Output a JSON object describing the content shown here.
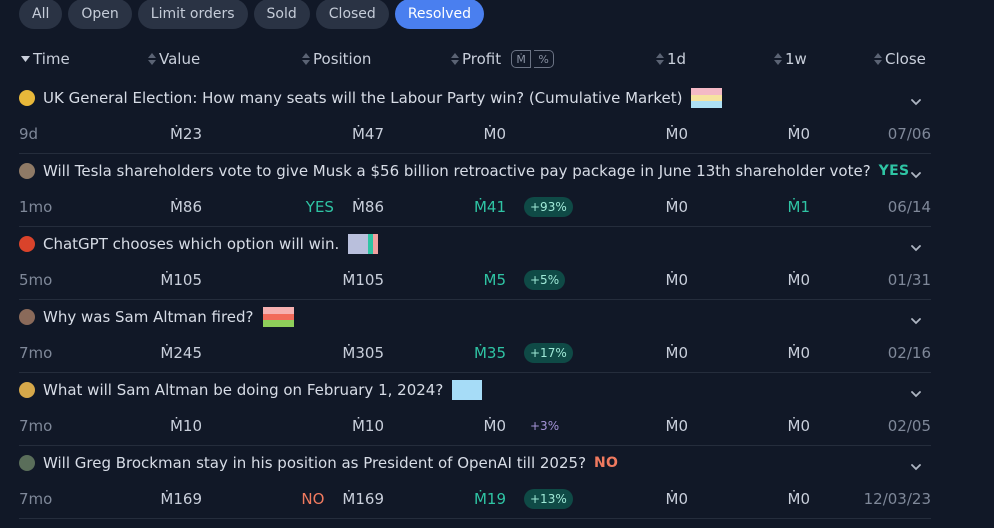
{
  "filters": [
    "All",
    "Open",
    "Limit orders",
    "Sold",
    "Closed",
    "Resolved"
  ],
  "active_filter": "Resolved",
  "columns": {
    "time": "Time",
    "value": "Value",
    "position": "Position",
    "profit": "Profit",
    "profit_toggle_mana": "Ṁ",
    "profit_toggle_pct": "%",
    "d1": "1d",
    "w1": "1w",
    "close": "Close"
  },
  "rows": [
    {
      "question": "UK General Election: How many seats will the Labour Party win? (Cumulative Market)",
      "resolution": "",
      "time": "9d",
      "value": "Ṁ23",
      "position_outcome": "",
      "position": "Ṁ47",
      "profit": "Ṁ0",
      "profit_pct": "",
      "d1": "Ṁ0",
      "w1": "Ṁ0",
      "close": "07/06",
      "avatar_color": "#e8b83a",
      "thumb_colors": [
        "#f4b9c6",
        "#f6e3a0",
        "#aee0f4"
      ]
    },
    {
      "question": "Will Tesla shareholders vote to give Musk a $56 billion retroactive pay package in June 13th shareholder vote?",
      "resolution": "YES",
      "time": "1mo",
      "value": "Ṁ86",
      "position_outcome": "YES",
      "position": "Ṁ86",
      "profit": "Ṁ41",
      "profit_pct": "+93%",
      "d1": "Ṁ0",
      "w1": "Ṁ1",
      "close": "06/14",
      "avatar_color": "#8f7a66",
      "thumb_colors": []
    },
    {
      "question": "ChatGPT chooses which option will win.",
      "resolution": "",
      "time": "5mo",
      "value": "Ṁ105",
      "position_outcome": "",
      "position": "Ṁ105",
      "profit": "Ṁ5",
      "profit_pct": "+5%",
      "d1": "Ṁ0",
      "w1": "Ṁ0",
      "close": "01/31",
      "avatar_color": "#d9432b",
      "thumb_colors": [
        "#b9bfdc",
        "#2fc4a4",
        "#f2a0a0"
      ]
    },
    {
      "question": "Why was Sam Altman fired?",
      "resolution": "",
      "time": "7mo",
      "value": "Ṁ245",
      "position_outcome": "",
      "position": "Ṁ305",
      "profit": "Ṁ35",
      "profit_pct": "+17%",
      "d1": "Ṁ0",
      "w1": "Ṁ0",
      "close": "02/16",
      "avatar_color": "#8a6a5a",
      "thumb_colors": [
        "#f6b0b0",
        "#f26a5a",
        "#8fce5a"
      ]
    },
    {
      "question": "What will Sam Altman be doing on February 1, 2024?",
      "resolution": "",
      "time": "7mo",
      "value": "Ṁ10",
      "position_outcome": "",
      "position": "Ṁ10",
      "profit": "Ṁ0",
      "profit_pct": "+3%",
      "d1": "Ṁ0",
      "w1": "Ṁ0",
      "close": "02/05",
      "avatar_color": "#d6a84a",
      "thumb_colors": [
        "#a6dcf7"
      ]
    },
    {
      "question": "Will Greg Brockman stay in his position as President of OpenAI till 2025?",
      "resolution": "NO",
      "time": "7mo",
      "value": "Ṁ169",
      "position_outcome": "NO",
      "position": "Ṁ169",
      "profit": "Ṁ19",
      "profit_pct": "+13%",
      "d1": "Ṁ0",
      "w1": "Ṁ0",
      "close": "12/03/23",
      "avatar_color": "#5a6e5a",
      "thumb_colors": []
    }
  ]
}
